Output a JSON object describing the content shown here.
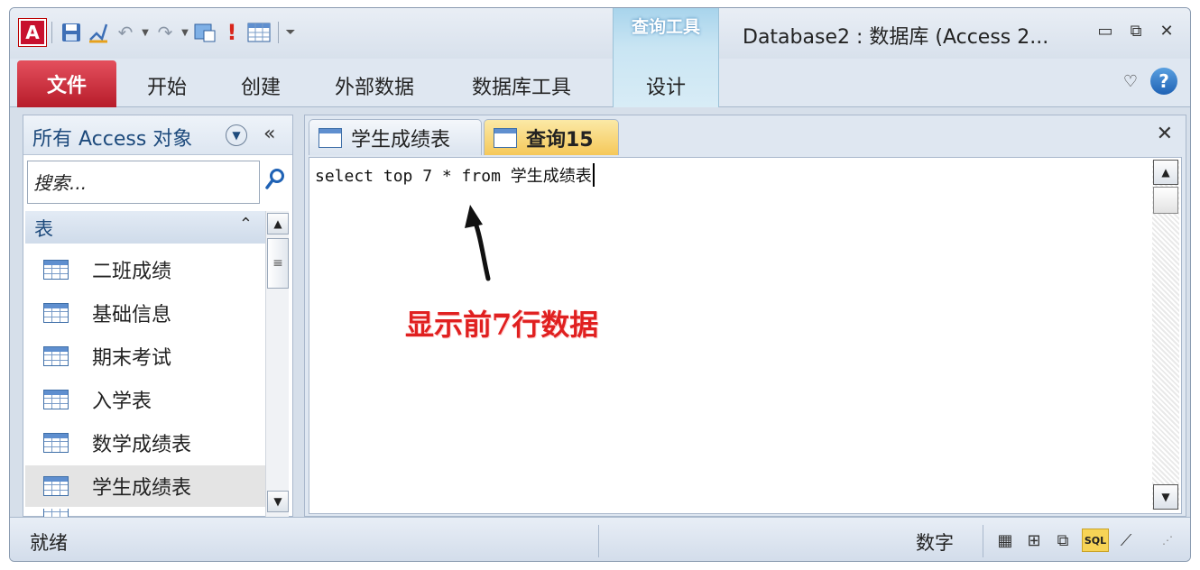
{
  "window": {
    "title": "Database2 : 数据库 (Access 2...",
    "context_tab_title": "查询工具"
  },
  "ribbon": {
    "file_tab": "文件",
    "tabs": [
      "开始",
      "创建",
      "外部数据",
      "数据库工具"
    ],
    "context_tab": "设计"
  },
  "nav": {
    "title": "所有 Access 对象",
    "collapse_glyph": "«",
    "search_placeholder": "搜索...",
    "group": "表",
    "items": [
      "二班成绩",
      "基础信息",
      "期末考试",
      "入学表",
      "数学成绩表",
      "学生成绩表"
    ],
    "selected_index": 5
  },
  "document": {
    "tabs": [
      "学生成绩表",
      "查询15"
    ],
    "active_tab": 1,
    "sql": "select top 7 * from 学生成绩表",
    "annotation": "显示前7行数据"
  },
  "status": {
    "text": "就绪",
    "num_lock": "数字",
    "sql_view_label": "SQL"
  },
  "colors": {
    "file_tab": "#b71c2a",
    "annotation": "#e02020",
    "active_doc_tab": "#f5c85a"
  }
}
